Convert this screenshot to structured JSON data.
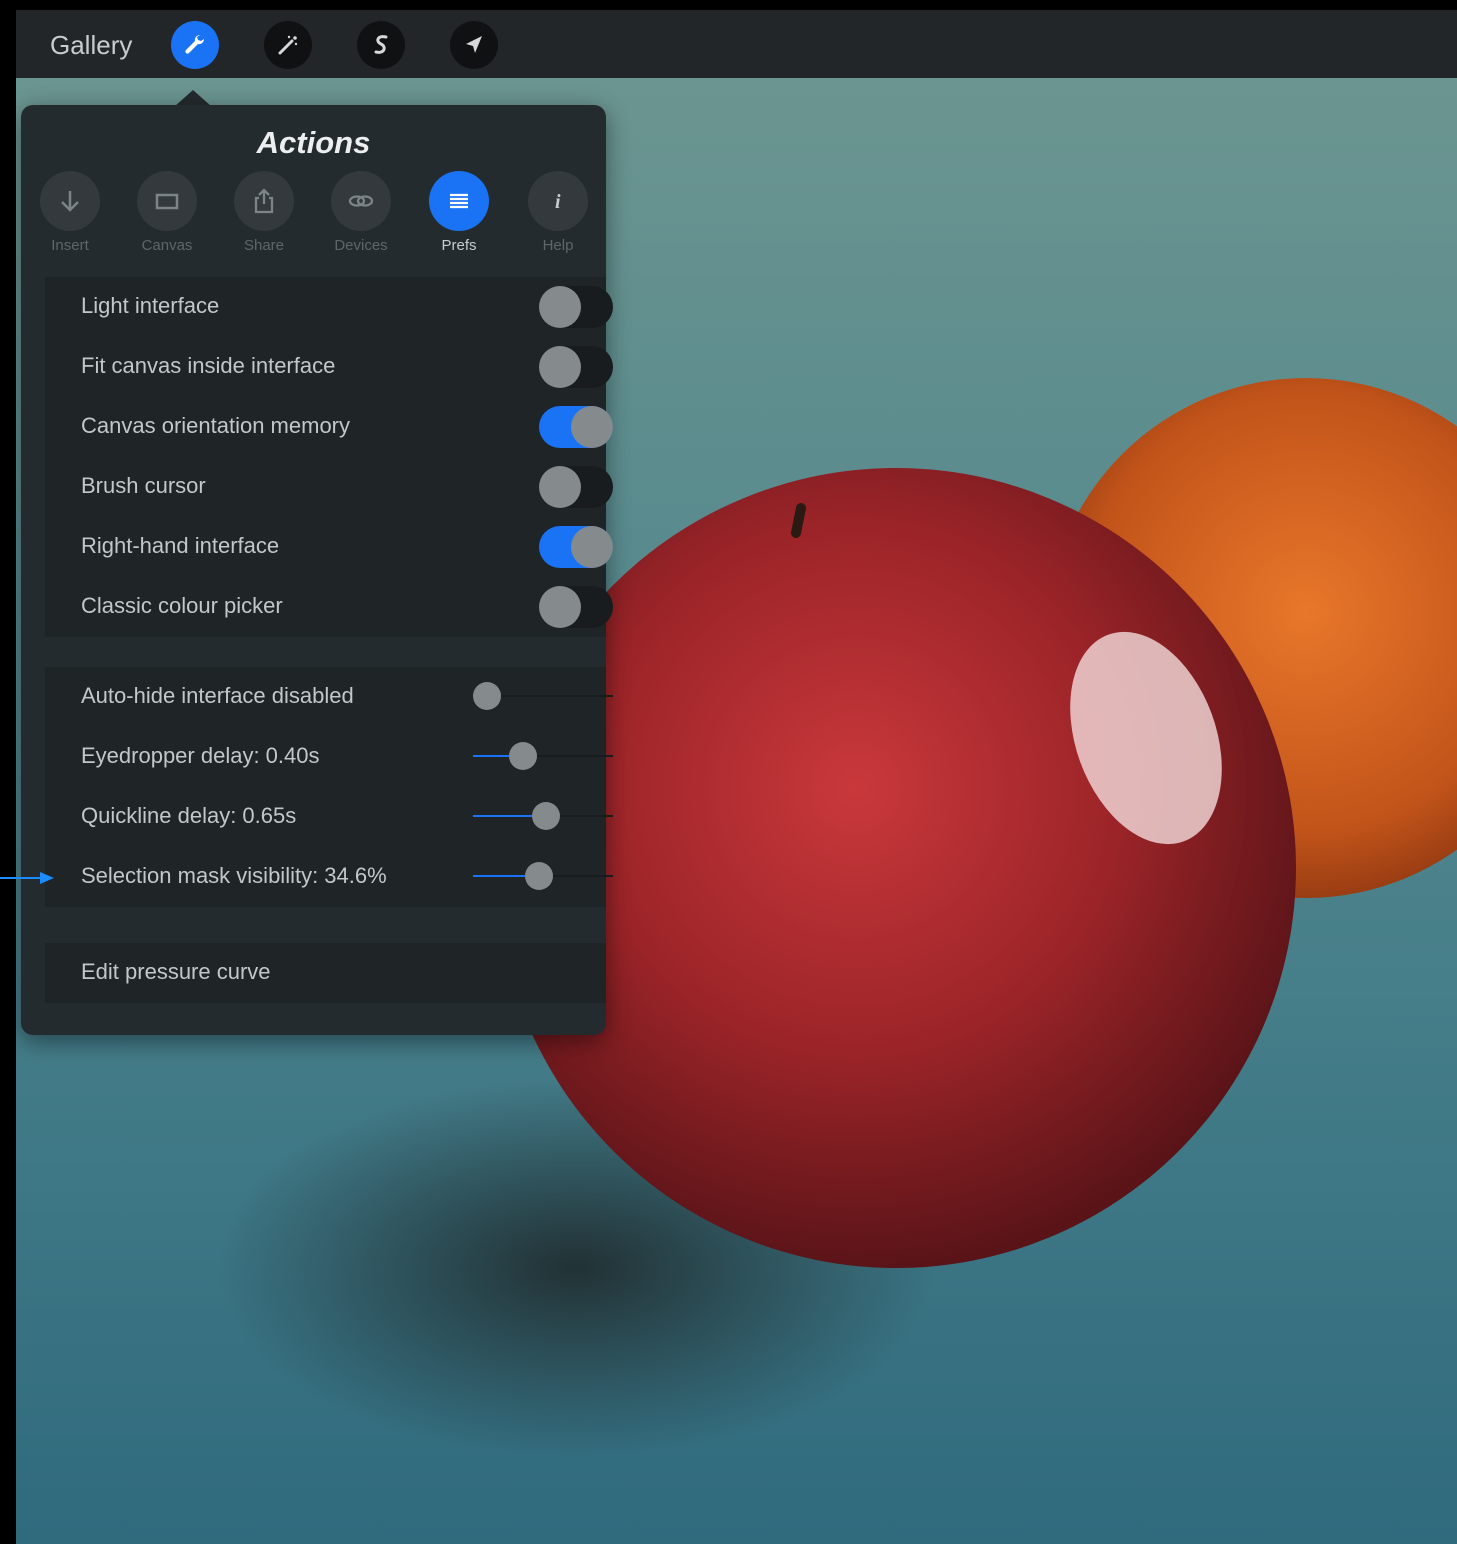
{
  "toolbar": {
    "gallery_label": "Gallery",
    "tools": [
      {
        "name": "actions",
        "icon": "wrench-icon",
        "active": true
      },
      {
        "name": "adjustments",
        "icon": "magic-wand-icon",
        "active": false
      },
      {
        "name": "selection",
        "icon": "selection-s-icon",
        "active": false
      },
      {
        "name": "transform",
        "icon": "arrow-cursor-icon",
        "active": false
      }
    ]
  },
  "actions_panel": {
    "title": "Actions",
    "tabs": [
      {
        "label": "Insert",
        "icon": "down-arrow-icon",
        "active": false
      },
      {
        "label": "Canvas",
        "icon": "rectangle-icon",
        "active": false
      },
      {
        "label": "Share",
        "icon": "share-icon",
        "active": false
      },
      {
        "label": "Devices",
        "icon": "link-icon",
        "active": false
      },
      {
        "label": "Prefs",
        "icon": "list-icon",
        "active": true
      },
      {
        "label": "Help",
        "icon": "info-icon",
        "active": false
      }
    ],
    "toggles": [
      {
        "label": "Light interface",
        "on": false
      },
      {
        "label": "Fit canvas inside interface",
        "on": false
      },
      {
        "label": "Canvas orientation memory",
        "on": true
      },
      {
        "label": "Brush cursor",
        "on": false
      },
      {
        "label": "Right-hand interface",
        "on": true
      },
      {
        "label": "Classic colour picker",
        "on": false
      }
    ],
    "sliders": [
      {
        "label": "Auto-hide interface disabled",
        "fraction": 0.0
      },
      {
        "label": "Eyedropper delay: 0.40s",
        "fraction": 0.26
      },
      {
        "label": "Quickline delay: 0.65s",
        "fraction": 0.42
      },
      {
        "label": "Selection mask visibility: 34.6%",
        "fraction": 0.37
      }
    ],
    "pressure_curve_label": "Edit pressure curve"
  },
  "colors": {
    "accent": "#1a73f5",
    "panel_bg": "#242b2e",
    "section_bg": "#1f2427"
  }
}
